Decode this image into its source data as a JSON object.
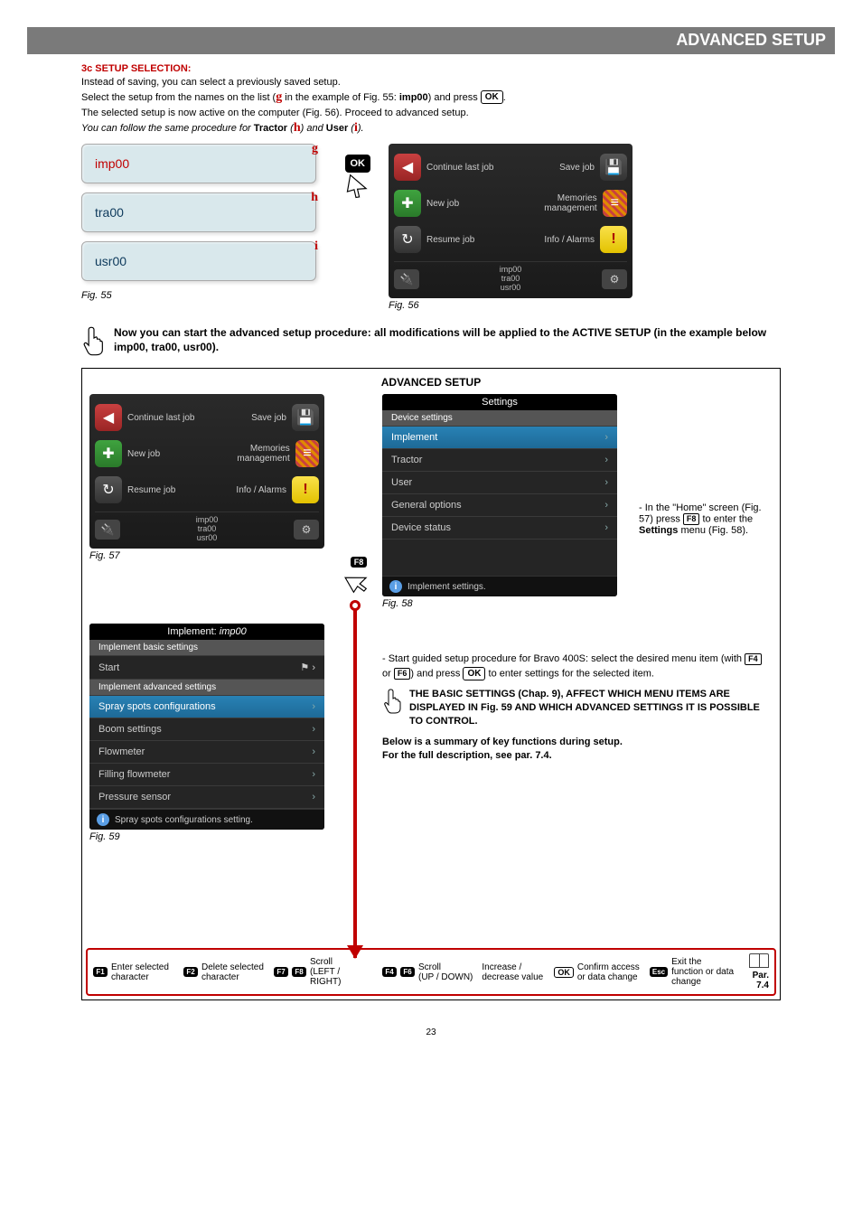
{
  "header": {
    "title": "ADVANCED SETUP"
  },
  "section3c": {
    "title": "3c SETUP SELECTION:",
    "line1": "Instead of saving, you can select a previously saved setup.",
    "line2_a": "Select the setup from the names on the list (",
    "line2_g": "g",
    "line2_b": " in the example of Fig. 55: ",
    "line2_imp": "imp00",
    "line2_c": ") and press ",
    "line2_ok": "OK",
    "line2_end": ".",
    "line3": "The selected setup is now active on the computer (Fig. 56). Proceed to advanced setup.",
    "line4_a": "You can follow the same procedure for ",
    "line4_tractor": "Tractor",
    "line4_lp": " (",
    "line4_h": "h",
    "line4_rp": ") ",
    "line4_and": "and ",
    "line4_user": "User",
    "line4_lp2": " (",
    "line4_i": "i",
    "line4_rp2": ").",
    "card_imp": "imp00",
    "card_tra": "tra00",
    "card_usr": "usr00",
    "letter_g": "g",
    "letter_h": "h",
    "letter_i": "i",
    "ok_label": "OK",
    "fig55": "Fig. 55",
    "fig56": "Fig. 56"
  },
  "screen56": {
    "continue": "Continue last job",
    "save": "Save job",
    "newjob": "New job",
    "memmgmt": "Memories management",
    "resume": "Resume job",
    "info": "Info / Alarms",
    "bottom1": "imp00",
    "bottom2": "tra00",
    "bottom3": "usr00"
  },
  "finger_note1": "Now you can start the advanced setup procedure: all modifications will be applied to the ACTIVE SETUP (in the example below imp00, tra00, usr00).",
  "advanced": {
    "title": "ADVANCED SETUP",
    "fig57": "Fig. 57",
    "fig58": "Fig. 58",
    "fig59": "Fig. 59",
    "f8": "F8",
    "right_note_a": "- In the \"Home\" screen (Fig. 57) press ",
    "right_note_f8": "F8",
    "right_note_b": " to enter the ",
    "right_note_settings": "Settings",
    "right_note_c": " menu (Fig. 58).",
    "para2_a": "- Start guided setup procedure for Bravo 400S: select the desired menu item (with ",
    "para2_f4": "F4",
    "para2_or": " or ",
    "para2_f6": "F6",
    "para2_b": ") and press ",
    "para2_ok": "OK",
    "para2_c": " to enter settings for the selected item.",
    "warn": "THE BASIC SETTINGS (Chap. 9), AFFECT WHICH MENU ITEMS ARE DISPLAYED IN Fig. 59 AND WHICH ADVANCED SETTINGS IT IS POSSIBLE TO CONTROL.",
    "summary1": "Below is a summary of key functions during setup.",
    "summary2": "For the full description, see par. 7.4."
  },
  "settingsScreen": {
    "title": "Settings",
    "device": "Device settings",
    "implement": "Implement",
    "tractor": "Tractor",
    "user": "User",
    "general": "General options",
    "status": "Device status",
    "footer": "Implement settings."
  },
  "implScreen": {
    "title_a": "Implement: ",
    "title_b": "imp00",
    "grp_basic": "Implement basic settings",
    "start": "Start",
    "grp_adv": "Implement advanced settings",
    "spray": "Spray spots configurations",
    "boom": "Boom settings",
    "flow": "Flowmeter",
    "fill": "Filling flowmeter",
    "press": "Pressure sensor",
    "footer": "Spray spots configurations setting."
  },
  "keyfooter": {
    "f1": "F1",
    "f1_desc": "Enter selected character",
    "f2": "F2",
    "f2_desc": "Delete selected character",
    "f7": "F7",
    "f8": "F8",
    "scroll_lr": "Scroll",
    "scroll_lr2": "(LEFT / RIGHT)",
    "f4": "F4",
    "f6": "F6",
    "scroll_ud": "Scroll",
    "scroll_ud2": "(UP / DOWN)",
    "incdec": "Increase / decrease value",
    "ok": "OK",
    "ok_desc": "Confirm access or data change",
    "esc": "Esc",
    "esc_desc": "Exit the function or data change",
    "par": "Par.",
    "par_num": "7.4"
  },
  "page_number": "23"
}
